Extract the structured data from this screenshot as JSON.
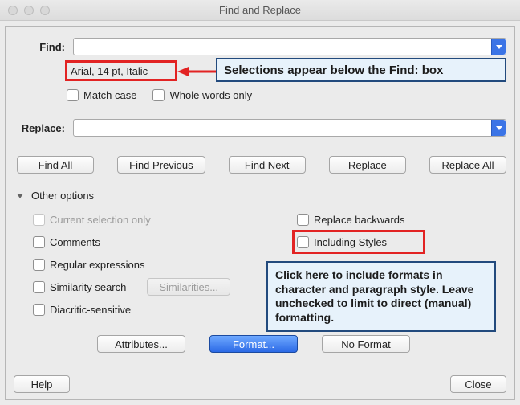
{
  "window": {
    "title": "Find and Replace"
  },
  "find": {
    "label": "Find:",
    "value": "",
    "format_summary": "Arial, 14 pt, Italic",
    "match_case_label": "Match case",
    "whole_words_label": "Whole words only"
  },
  "replace": {
    "label": "Replace:",
    "value": ""
  },
  "buttons": {
    "find_all": "Find All",
    "find_prev": "Find Previous",
    "find_next": "Find Next",
    "replace": "Replace",
    "replace_all": "Replace All",
    "attributes": "Attributes...",
    "format": "Format...",
    "no_format": "No Format",
    "similarities": "Similarities...",
    "help": "Help",
    "close": "Close"
  },
  "other": {
    "header": "Other options",
    "current_selection": "Current selection only",
    "comments": "Comments",
    "regex": "Regular expressions",
    "similarity": "Similarity search",
    "diacritic": "Diacritic-sensitive",
    "replace_backwards": "Replace backwards",
    "including_styles": "Including Styles"
  },
  "annotations": {
    "find_note": "Selections appear below the Find: box",
    "styles_note": "Click here to include formats in character and paragraph style. Leave unchecked to limit to direct (manual) formatting."
  },
  "colors": {
    "accent_red": "#e22323",
    "accent_blue": "#224a7d",
    "primary_button": "#2b69e6"
  }
}
